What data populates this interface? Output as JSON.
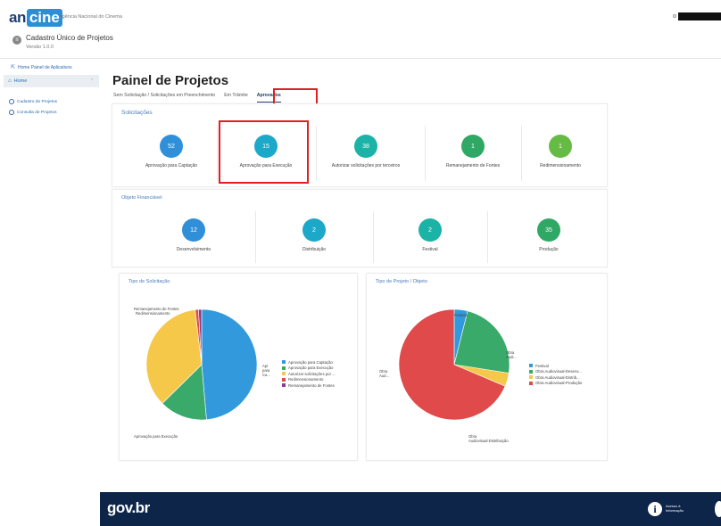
{
  "header": {
    "logo_part1": "an",
    "logo_part2": "cine",
    "agency_name": "Agência Nacional do Cinema",
    "system_title": "Cadastro Único de Projetos",
    "system_version": "Versão 1.0.0"
  },
  "sidebar": {
    "home_link": "Home Painel de Aplicativos",
    "section_label": "Home",
    "items": [
      {
        "label": "Cadastro de Projetos"
      },
      {
        "label": "Consulta de Projetos"
      }
    ]
  },
  "main": {
    "title": "Painel de Projetos",
    "tabs": [
      {
        "label": "Sem Solicitação / Solicitações em Preenchimento",
        "active": false
      },
      {
        "label": "Em Trâmite",
        "active": false
      },
      {
        "label": "Aprovados",
        "active": true
      }
    ]
  },
  "solicitacoes": {
    "title": "Solicitações",
    "items": [
      {
        "value": "52",
        "label": "Aprovação para Captação",
        "color": "#2f8fd8"
      },
      {
        "value": "15",
        "label": "Aprovação para Execução",
        "color": "#1ba8c9"
      },
      {
        "value": "38",
        "label": "Autorizar solicitações por terceiros",
        "color": "#1ab3a6"
      },
      {
        "value": "1",
        "label": "Remanejamento de Fontes",
        "color": "#2fa866"
      },
      {
        "value": "1",
        "label": "Redimensionamento",
        "color": "#66bb44"
      }
    ]
  },
  "objeto_financiavel": {
    "title": "Objeto Financiável",
    "items": [
      {
        "value": "12",
        "label": "Desenvolvimento",
        "color": "#2f8fd8"
      },
      {
        "value": "2",
        "label": "Distribuição",
        "color": "#1ba8c9"
      },
      {
        "value": "2",
        "label": "Festival",
        "color": "#1ab3a6"
      },
      {
        "value": "35",
        "label": "Produção",
        "color": "#2fa866"
      }
    ]
  },
  "tipo_solicitacao": {
    "title": "Tipo de Solicitação",
    "legend": [
      {
        "label": "Aprovação para Captação",
        "color": "#3399dd"
      },
      {
        "label": "Aprovação para Execução",
        "color": "#3aaa6a"
      },
      {
        "label": "Autorizar solicitações por ...",
        "color": "#f5c84a"
      },
      {
        "label": "Redimensionamento",
        "color": "#e04a4a"
      },
      {
        "label": "Remanejamento de Fontes",
        "color": "#8a3d8a"
      }
    ],
    "slice_labels": {
      "remanejamento": "Remanejamento de Fontes",
      "redimensionamento": "Redimensionamento",
      "execucao": "Aprovação para Execução",
      "captacao_1": "Apr",
      "captacao_2": "para",
      "captacao_3": "Ca..."
    },
    "values": [
      52,
      15,
      38,
      1,
      1
    ]
  },
  "tipo_projeto": {
    "title": "Tipo de Projeto / Objeto",
    "legend": [
      {
        "label": "Festival",
        "color": "#3399dd"
      },
      {
        "label": "Obra Audiovisual-Desenv...",
        "color": "#3aaa6a"
      },
      {
        "label": "Obra Audiovisual-Distrib...",
        "color": "#f5c84a"
      },
      {
        "label": "Obra Audiovisual-Produção",
        "color": "#e04a4a"
      }
    ],
    "slice_labels": {
      "festival": "Festival",
      "desenv_1": "Obra",
      "desenv_2": "Audi...",
      "prod_1": "Obra",
      "prod_2": "Aud...",
      "distrib_1": "Obra",
      "distrib_2": "Audiovisual-Distribuição"
    },
    "values": [
      2,
      12,
      2,
      35
    ]
  },
  "footer": {
    "brand": "gov.br",
    "info_line1": "Acesso à",
    "info_line2": "Informação"
  }
}
